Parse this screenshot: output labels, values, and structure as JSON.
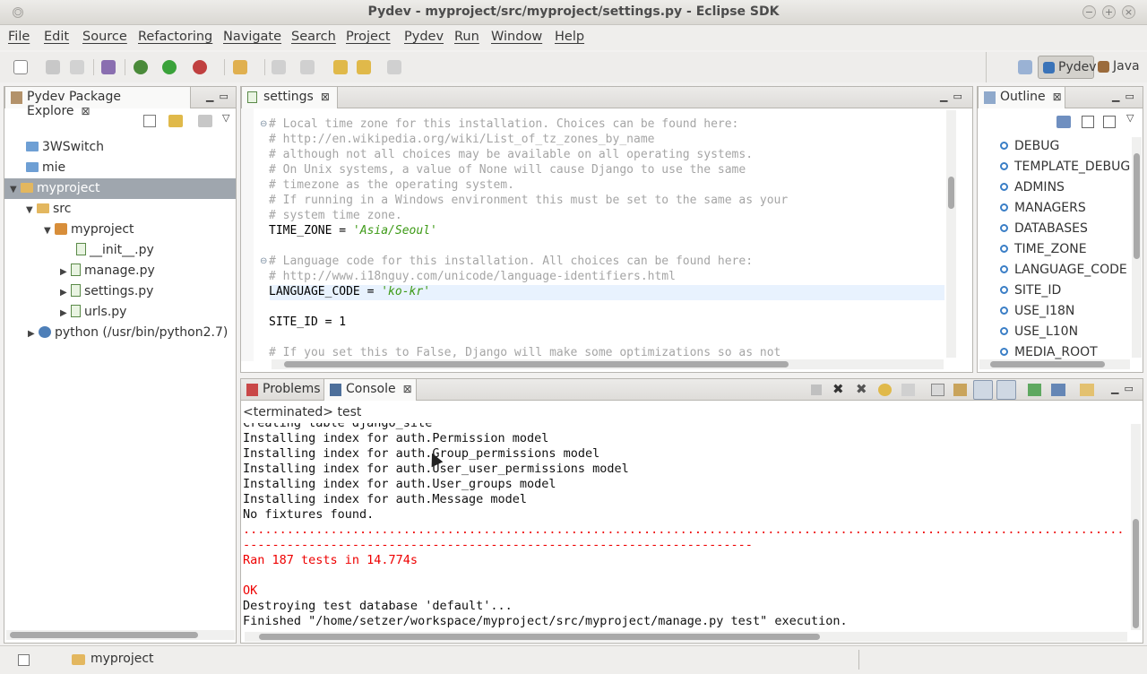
{
  "window": {
    "title": "Pydev - myproject/src/myproject/settings.py - Eclipse SDK"
  },
  "menu": [
    "File",
    "Edit",
    "Source",
    "Refactoring",
    "Navigate",
    "Search",
    "Project",
    "Pydev",
    "Run",
    "Window",
    "Help"
  ],
  "perspectives": {
    "pydev": "Pydev",
    "java": "Java"
  },
  "explorer": {
    "tab": "Pydev Package Explore",
    "items": [
      {
        "label": "3WSwitch"
      },
      {
        "label": "mie"
      },
      {
        "label": "myproject"
      },
      {
        "label": "src"
      },
      {
        "label": "myproject"
      },
      {
        "label": "__init__.py"
      },
      {
        "label": "manage.py"
      },
      {
        "label": "settings.py"
      },
      {
        "label": "urls.py"
      },
      {
        "label": "python (/usr/bin/python2.7)"
      }
    ]
  },
  "editor": {
    "tab": "settings",
    "lines": [
      {
        "c": "# Local time zone for this installation. Choices can be found here:"
      },
      {
        "c": "# http://en.wikipedia.org/wiki/List_of_tz_zones_by_name"
      },
      {
        "c": "# although not all choices may be available on all operating systems."
      },
      {
        "c": "# On Unix systems, a value of None will cause Django to use the same"
      },
      {
        "c": "# timezone as the operating system."
      },
      {
        "c": "# If running in a Windows environment this must be set to the same as your"
      },
      {
        "c": "# system time zone."
      },
      {
        "a": "TIME_ZONE = ",
        "s": "'Asia/Seoul'"
      },
      {
        "a": ""
      },
      {
        "c": "# Language code for this installation. All choices can be found here:"
      },
      {
        "c": "# http://www.i18nguy.com/unicode/language-identifiers.html"
      },
      {
        "a": "LANGUAGE_CODE = ",
        "s": "'ko-kr'"
      },
      {
        "a": ""
      },
      {
        "a": "SITE_ID = 1"
      },
      {
        "a": ""
      },
      {
        "c": "# If you set this to False, Django will make some optimizations so as not"
      }
    ]
  },
  "outline": {
    "tab": "Outline",
    "items": [
      "DEBUG",
      "TEMPLATE_DEBUG",
      "ADMINS",
      "MANAGERS",
      "DATABASES",
      "TIME_ZONE",
      "LANGUAGE_CODE",
      "SITE_ID",
      "USE_I18N",
      "USE_L10N",
      "MEDIA_ROOT"
    ]
  },
  "console": {
    "tabs": {
      "problems": "Problems",
      "console": "Console"
    },
    "status": "<terminated> test",
    "lines": [
      {
        "t": "Creating table django_site",
        "k": "n"
      },
      {
        "t": "Installing index for auth.Permission model",
        "k": "n"
      },
      {
        "t": "Installing index for auth.Group_permissions model",
        "k": "n"
      },
      {
        "t": "Installing index for auth.User_user_permissions model",
        "k": "n"
      },
      {
        "t": "Installing index for auth.User_groups model",
        "k": "n"
      },
      {
        "t": "Installing index for auth.Message model",
        "k": "n"
      },
      {
        "t": "No fixtures found.",
        "k": "n"
      },
      {
        "t": ".............................................................................................................................................................................................",
        "k": "r"
      },
      {
        "t": "----------------------------------------------------------------------",
        "k": "r"
      },
      {
        "t": "Ran 187 tests in 14.774s",
        "k": "r"
      },
      {
        "t": "",
        "k": "n"
      },
      {
        "t": "OK",
        "k": "r"
      },
      {
        "t": "Destroying test database 'default'...",
        "k": "n"
      },
      {
        "t": "Finished \"/home/setzer/workspace/myproject/src/myproject/manage.py test\" execution.",
        "k": "n"
      }
    ]
  },
  "status": {
    "project": "myproject"
  },
  "colors": {
    "selection": "#9fa6ae",
    "string": "#3d9a16",
    "error": "#e00000",
    "comment": "#a5a5a5"
  }
}
